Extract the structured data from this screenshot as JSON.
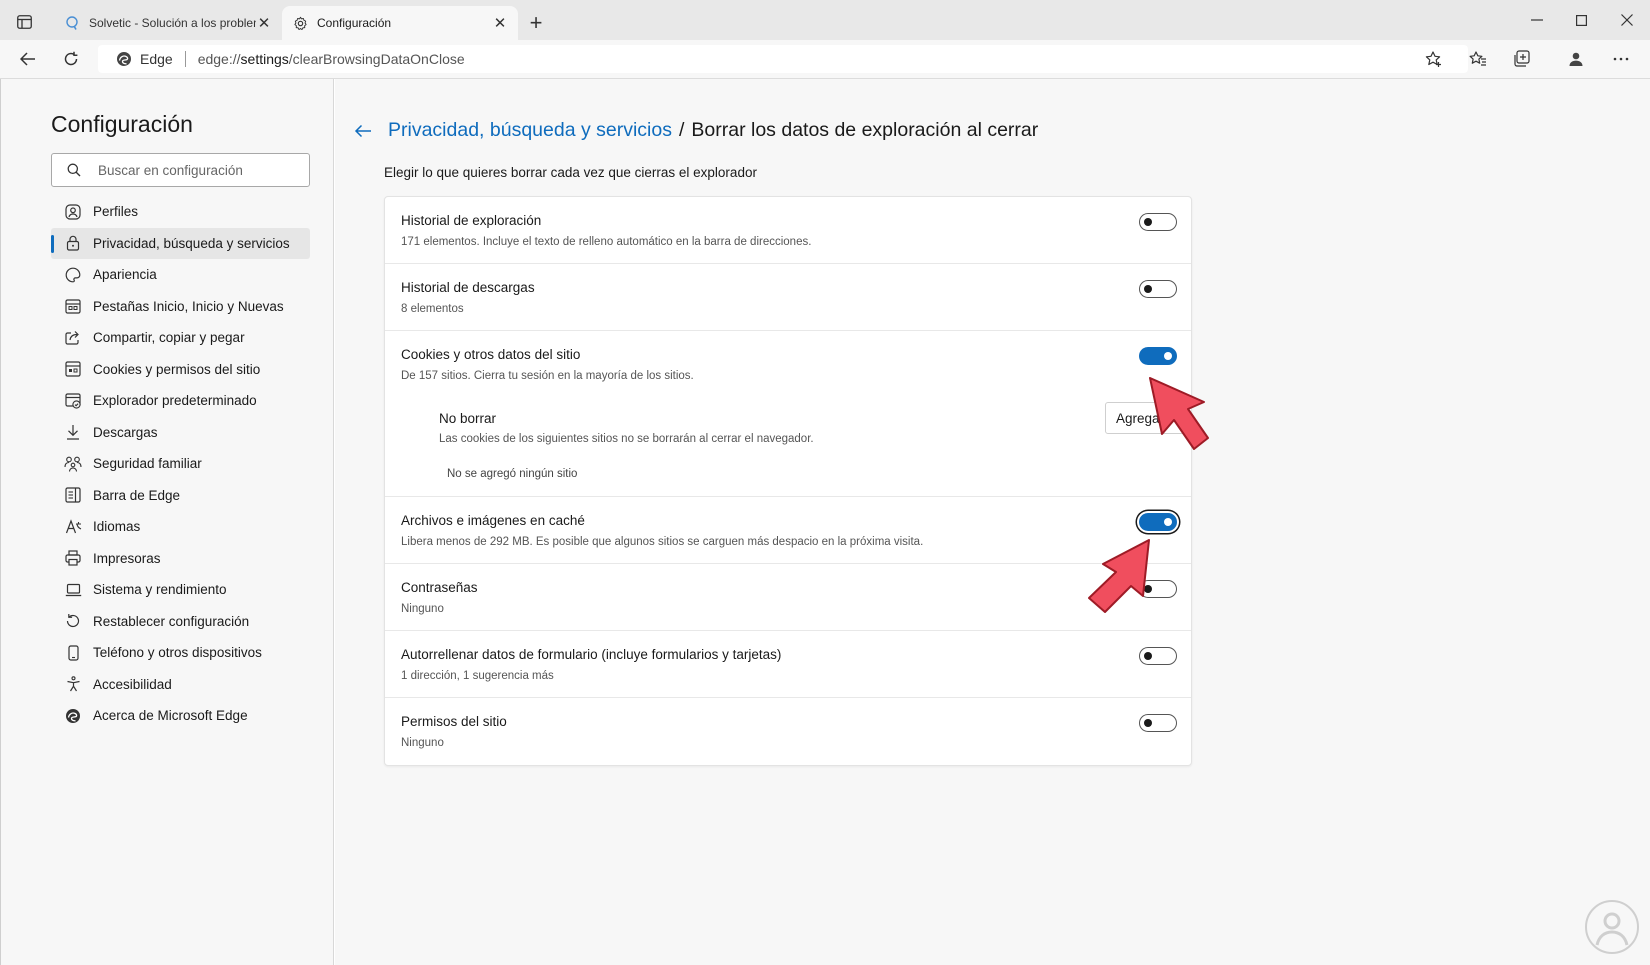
{
  "browser": {
    "tabs": [
      {
        "title": "Solvetic - Solución a los problem",
        "active": false
      },
      {
        "title": "Configuración",
        "active": true
      }
    ],
    "address": {
      "site_label": "Edge",
      "url_prefix": "edge://",
      "url_main": "settings",
      "url_suffix": "/clearBrowsingDataOnClose"
    },
    "accent": "#0f6cbd"
  },
  "sidebar": {
    "title": "Configuración",
    "search_placeholder": "Buscar en configuración",
    "items": [
      {
        "label": "Perfiles",
        "icon": "profile-icon"
      },
      {
        "label": "Privacidad, búsqueda y servicios",
        "icon": "lock-icon",
        "selected": true
      },
      {
        "label": "Apariencia",
        "icon": "palette-icon"
      },
      {
        "label": "Pestañas Inicio, Inicio y Nuevas",
        "icon": "tabs-icon"
      },
      {
        "label": "Compartir, copiar y pegar",
        "icon": "share-icon"
      },
      {
        "label": "Cookies y permisos del sitio",
        "icon": "site-permissions-icon"
      },
      {
        "label": "Explorador predeterminado",
        "icon": "default-browser-icon"
      },
      {
        "label": "Descargas",
        "icon": "download-icon"
      },
      {
        "label": "Seguridad familiar",
        "icon": "family-icon"
      },
      {
        "label": "Barra de Edge",
        "icon": "edge-bar-icon"
      },
      {
        "label": "Idiomas",
        "icon": "language-icon"
      },
      {
        "label": "Impresoras",
        "icon": "printer-icon"
      },
      {
        "label": "Sistema y rendimiento",
        "icon": "laptop-icon"
      },
      {
        "label": "Restablecer configuración",
        "icon": "reset-icon"
      },
      {
        "label": "Teléfono y otros dispositivos",
        "icon": "phone-icon"
      },
      {
        "label": "Accesibilidad",
        "icon": "accessibility-icon"
      },
      {
        "label": "Acerca de Microsoft Edge",
        "icon": "edge-icon"
      }
    ]
  },
  "main": {
    "breadcrumb_parent": "Privacidad, búsqueda y servicios",
    "breadcrumb_separator": "/",
    "breadcrumb_current": "Borrar los datos de exploración al cerrar",
    "description": "Elegir lo que quieres borrar cada vez que cierras el explorador",
    "options": [
      {
        "title": "Historial de exploración",
        "subtitle": "171 elementos. Incluye el texto de relleno automático en la barra de direcciones.",
        "on": false
      },
      {
        "title": "Historial de descargas",
        "subtitle": "8 elementos",
        "on": false
      },
      {
        "title": "Cookies y otros datos del sitio",
        "subtitle": "De 157 sitios. Cierra tu sesión en la mayoría de los sitios.",
        "on": true
      },
      {
        "title": "Archivos e imágenes en caché",
        "subtitle": "Libera menos de 292 MB. Es posible que algunos sitios se carguen más despacio en la próxima visita.",
        "on": true
      },
      {
        "title": "Contraseñas",
        "subtitle": "Ninguno",
        "on": false
      },
      {
        "title": "Autorrellenar datos de formulario (incluye formularios y tarjetas)",
        "subtitle": "1 dirección, 1 sugerencia más",
        "on": false
      },
      {
        "title": "Permisos del sitio",
        "subtitle": "Ninguno",
        "on": false
      }
    ],
    "no_borrar": {
      "title": "No borrar",
      "subtitle": "Las cookies de los siguientes sitios no se borrarán al cerrar el navegador.",
      "empty_text": "No se agregó ningún sitio",
      "add_button": "Agregar"
    }
  }
}
